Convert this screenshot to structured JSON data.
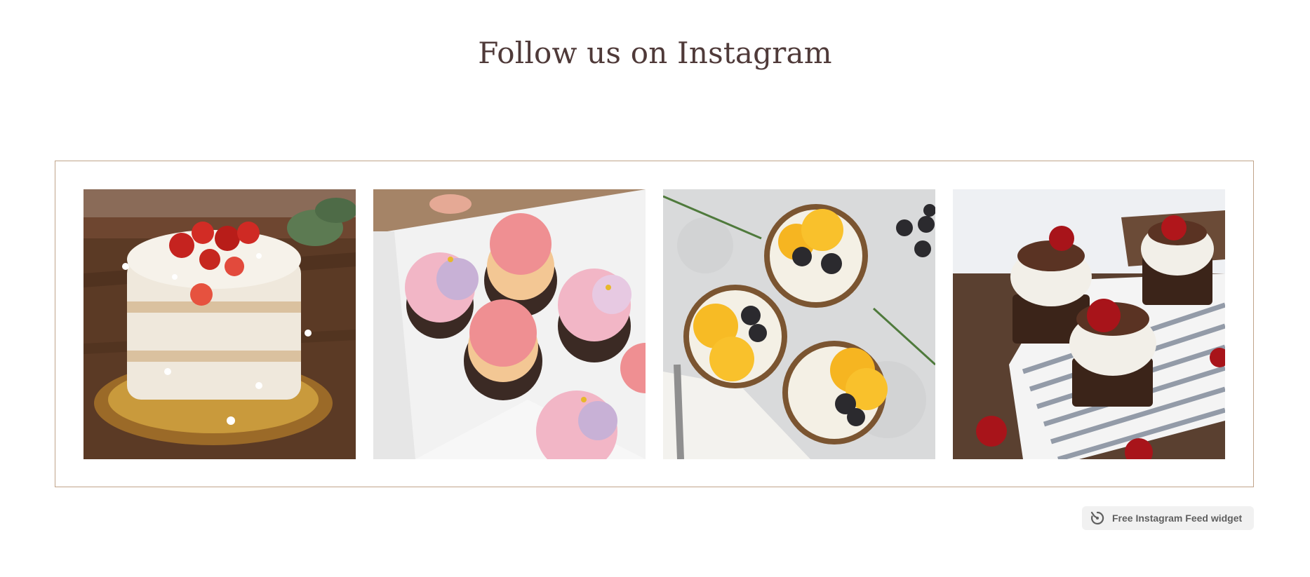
{
  "section": {
    "title": "Follow us on Instagram"
  },
  "feed": {
    "posts": [
      {
        "image": "naked-cake-strawberries",
        "description_icon": "cake-icon"
      },
      {
        "image": "cupcakes-box-pink",
        "description_icon": "cupcake-icon"
      },
      {
        "image": "citrus-berry-tarts",
        "description_icon": "tart-icon"
      },
      {
        "image": "chocolate-cherry-cupcakes",
        "description_icon": "cherry-icon"
      }
    ],
    "border_color": "#c0a48a"
  },
  "widget_badge": {
    "label": "Free Instagram Feed widget",
    "icon": "elfsight-logo-icon"
  },
  "colors": {
    "title": "#4f3a39",
    "badge_bg": "#f1f1f1",
    "badge_text": "#5f5f5f"
  }
}
